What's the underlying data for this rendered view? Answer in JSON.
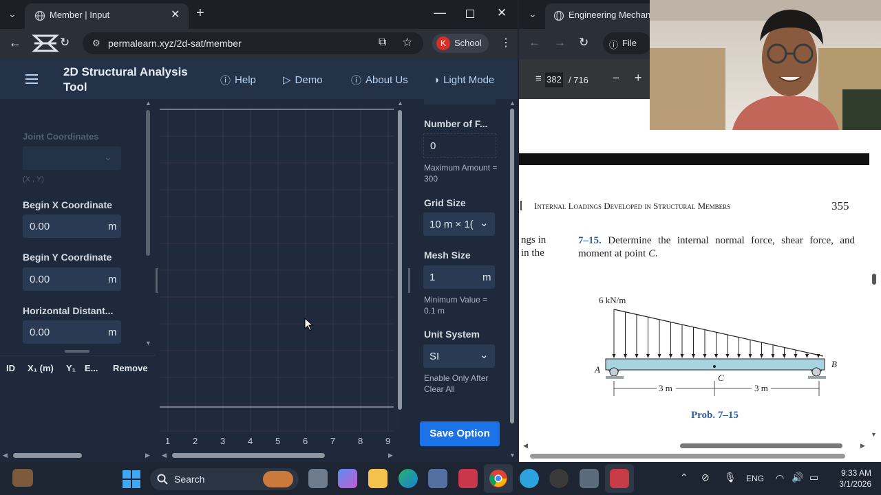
{
  "left_browser": {
    "tab_title": "Member | Input",
    "url": "permalearn.xyz/2d-sat/member",
    "profile_initial": "K",
    "profile_name": "School"
  },
  "app": {
    "title": "2D Structural Analysis Tool",
    "nav": {
      "help": "Help",
      "demo": "Demo",
      "about": "About Us",
      "light_mode": "Light Mode"
    }
  },
  "left_panel": {
    "joint_coordinates_label": "Joint Coordinates",
    "joint_coordinates_hint": "(X , Y)",
    "begin_x_label": "Begin X Coordinate",
    "begin_x_value": "0.00",
    "begin_y_label": "Begin Y Coordinate",
    "begin_y_value": "0.00",
    "horizontal_label": "Horizontal Distant...",
    "horizontal_value": "0.00",
    "unit_m": "m"
  },
  "member_table": {
    "headers": [
      "ID",
      "X₁ (m)",
      "Y₁",
      "E...",
      "Remove"
    ]
  },
  "canvas": {
    "x_ticks": [
      "1",
      "2",
      "3",
      "4",
      "5",
      "6",
      "7",
      "8",
      "9"
    ]
  },
  "right_panel": {
    "number_label": "Number of F...",
    "number_value": "0",
    "max_note": "Maximum Amount = 300",
    "grid_label": "Grid Size",
    "grid_value": "10 m × 1(",
    "mesh_label": "Mesh Size",
    "mesh_value": "1",
    "mesh_unit": "m",
    "mesh_note": "Minimum Value = 0.1 m",
    "unit_label": "Unit System",
    "unit_value": "SI",
    "unit_note": "Enable Only After Clear All",
    "save_button": "Save Option"
  },
  "right_browser": {
    "tab_title": "Engineering Mechanic",
    "file_label": "File",
    "pdf_page": "382",
    "pdf_total": "/ 716"
  },
  "pdf": {
    "header_text": "Internal Loadings Developed in Structural Members",
    "page_number": "355",
    "left_frag_1": "ngs in",
    "left_frag_2": "in the",
    "problem_number": "7–15.",
    "problem_text": "Determine the internal normal force, shear force, and moment at point",
    "problem_point": "C.",
    "load_label": "6 kN/m",
    "point_a": "A",
    "point_b": "B",
    "point_c": "C",
    "dim_1": "3 m",
    "dim_2": "3 m",
    "caption": "Prob. 7–15"
  },
  "taskbar": {
    "search": "Search",
    "lang": "ENG",
    "time": "9:33 AM",
    "date": "3/1/2026"
  }
}
